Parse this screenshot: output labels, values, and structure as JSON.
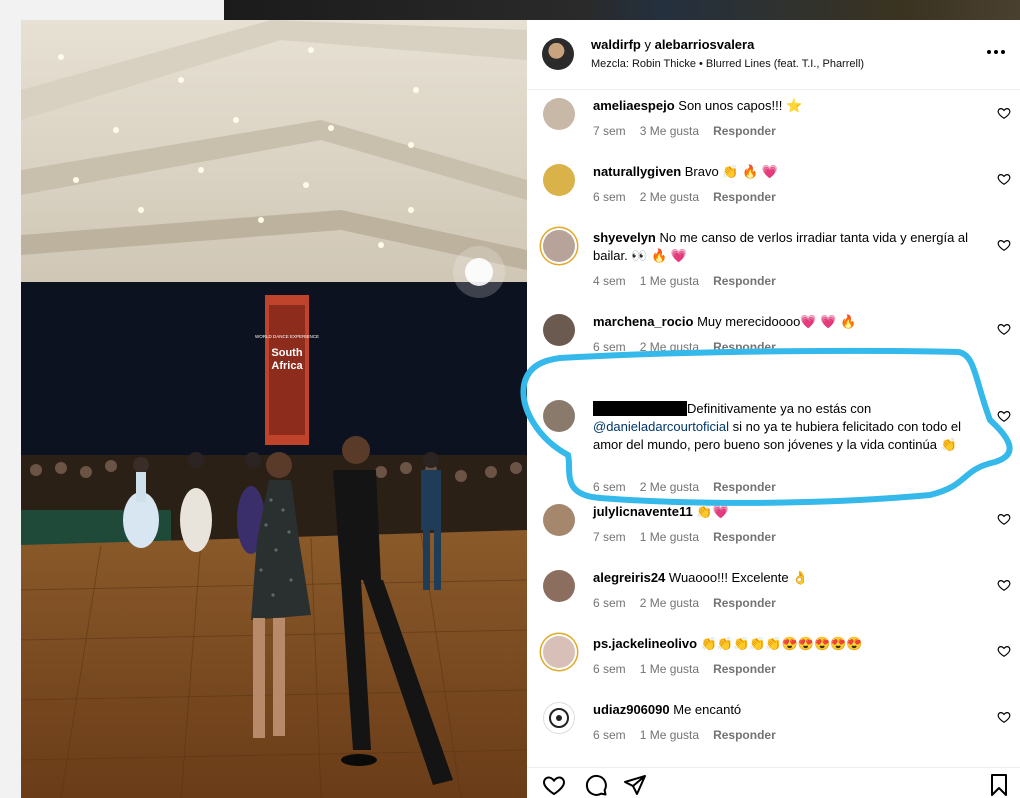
{
  "post": {
    "header": {
      "author_1": "waldirfp",
      "joiner": "y",
      "author_2": "alebarriosvalera",
      "audio": "Mezcla: Robin Thicke • Blurred Lines (feat. T.I., Pharrell)",
      "more_icon": "more-horizontal-icon"
    },
    "photo": {
      "banner_line1": "WORLD DANCE EXPERIENCE",
      "banner_line2": "South",
      "banner_line3": "Africa"
    },
    "comments": [
      {
        "user": "ameliaespejo",
        "text": "Son unos capos!!! ⭐",
        "time": "7 sem",
        "likes": "3 Me gusta",
        "reply": "Responder",
        "avatar_color": "#c8b8a8"
      },
      {
        "user": "naturallygiven",
        "text": "Bravo 👏 🔥 💗",
        "time": "6 sem",
        "likes": "2 Me gusta",
        "reply": "Responder",
        "avatar_color": "#d9b24a"
      },
      {
        "user": "shyevelyn",
        "text": "No me canso de verlos irradiar tanta vida y energía al bailar. 👀 🔥 💗",
        "time": "4 sem",
        "likes": "1 Me gusta",
        "reply": "Responder",
        "avatar_color": "#b7a39a"
      },
      {
        "user": "marchena_rocio",
        "text": "Muy merecidoooo💗 💗 🔥",
        "time": "6 sem",
        "likes": "2 Me gusta",
        "reply": "Responder",
        "avatar_color": "#6b5a50"
      },
      {
        "user": "",
        "text_before": "Definitivamente ya no estás con",
        "mention": "@danieladarcourtoficial",
        "text_after": " si no ya te hubiera felicitado con todo el amor del mundo, pero bueno son jóvenes y la vida continúa 👏",
        "time": "6 sem",
        "likes": "2 Me gusta",
        "reply": "Responder",
        "avatar_color": "#8a7a6c"
      },
      {
        "user": "julylicnavente11",
        "text": "👏💗",
        "time": "7 sem",
        "likes": "1 Me gusta",
        "reply": "Responder",
        "avatar_color": "#a5876e"
      },
      {
        "user": "alegreiris24",
        "text": "Wuaooo!!! Excelente 👌",
        "time": "6 sem",
        "likes": "2 Me gusta",
        "reply": "Responder",
        "avatar_color": "#8c6e5e"
      },
      {
        "user": "ps.jackelineolivo",
        "text": "👏👏👏👏👏😍😍😍😍😍",
        "time": "6 sem",
        "likes": "1 Me gusta",
        "reply": "Responder",
        "avatar_color": "#d8c0b8"
      },
      {
        "user": "udiaz906090",
        "text": "Me encantó",
        "time": "6 sem",
        "likes": "1 Me gusta",
        "reply": "Responder",
        "avatar_color": "#ffffff"
      }
    ],
    "actions": {
      "like_icon": "heart-icon",
      "comment_icon": "comment-icon",
      "share_icon": "share-icon",
      "save_icon": "bookmark-icon"
    },
    "highlight_color": "#35b8ea"
  }
}
